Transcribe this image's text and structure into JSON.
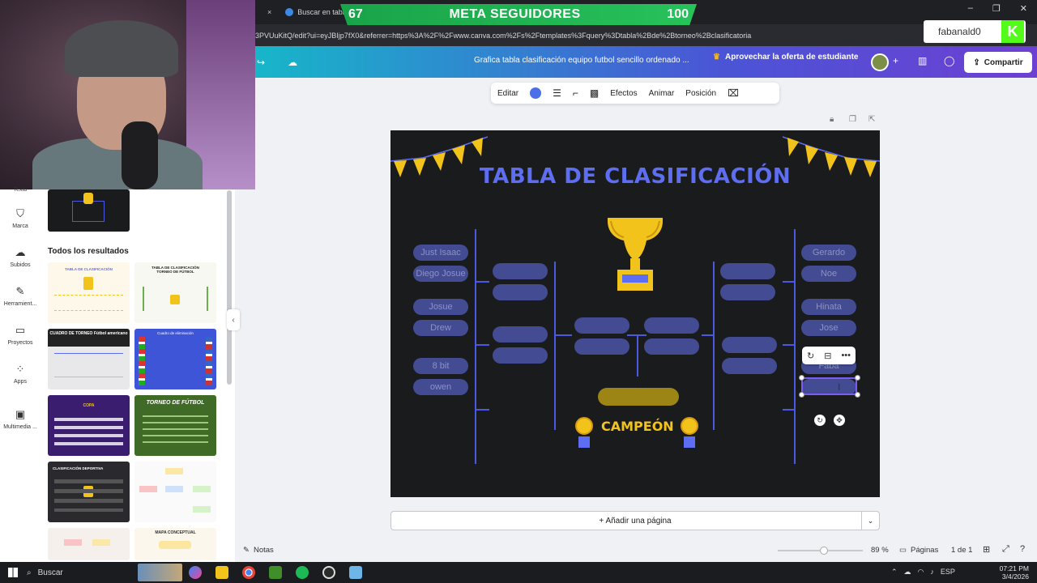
{
  "overlay": {
    "goal_current": "67",
    "goal_title": "META SEGUIDORES",
    "goal_target": "100",
    "progress_fraction": 0.67,
    "username": "fabanald0",
    "kick_badge": "K"
  },
  "browser": {
    "tab_label": "Buscar en tabl",
    "url": "3PVUuKitQ/edit?ui=eyJBIjp7fX0&referrer=https%3A%2F%2Fwww.canva.com%2Fs%2Ftemplates%3Fquery%3Dtabla%2Bde%2Btorneo%2Bclasificatoria"
  },
  "header": {
    "doc_name": "Grafica tabla clasificación equipo futbol sencillo ordenado ...",
    "offer": "Aprovechar la oferta de estudiante",
    "share": "Compartir"
  },
  "rail": {
    "items": [
      {
        "label": "Texto"
      },
      {
        "label": "Marca"
      },
      {
        "label": "Subidos"
      },
      {
        "label": "Herramient..."
      },
      {
        "label": "Proyectos"
      },
      {
        "label": "Apps"
      },
      {
        "label": "Multimedia ..."
      }
    ]
  },
  "panel": {
    "heading": "Todos los resultados",
    "thumbs": [
      {
        "title": "TABLA DE CLASIFICACIÓN"
      },
      {
        "title": "TABLA DE CLASIFICACIÓN TORNEO DE FÚTBOL"
      },
      {
        "title": "CUADRO DE TORNEO Fútbol americano"
      },
      {
        "title": "Cuadro de eliminación"
      },
      {
        "title": "COPA"
      },
      {
        "title": "TORNEO DE FÚTBOL"
      },
      {
        "title": "CLASIFICACIÓN DEPORTIVA"
      },
      {
        "title": ""
      },
      {
        "title": ""
      },
      {
        "title": "MAPA CONCEPTUAL"
      }
    ]
  },
  "toolbar": {
    "edit": "Editar",
    "effects": "Efectos",
    "animate": "Animar",
    "position": "Posición"
  },
  "design": {
    "title": "TABLA DE CLASIFICACIÓN",
    "left_names": [
      "Just Isaac",
      "Diego Josue",
      "Josue",
      "Drew",
      "8 bit",
      "owen"
    ],
    "right_names": [
      "Gerardo",
      "Noe",
      "Hinata",
      "Jose",
      "Faba"
    ],
    "champion": "CAMPEÓN"
  },
  "pages": {
    "add_page": "+ Añadir una página",
    "notes": "Notas",
    "zoom": "89 %",
    "pages_label": "Páginas",
    "page_count": "1 de 1",
    "zoom_fraction": 0.53
  },
  "taskbar": {
    "search": "Buscar",
    "lang": "ESP",
    "time": "07:21 PM",
    "date": "3/4/2026"
  },
  "colors": {
    "accent": "#5e6ef2",
    "slot": "#434c93",
    "gold": "#f2c31b",
    "goal_green": "#1aa34a",
    "kick_green": "#53fc18"
  }
}
